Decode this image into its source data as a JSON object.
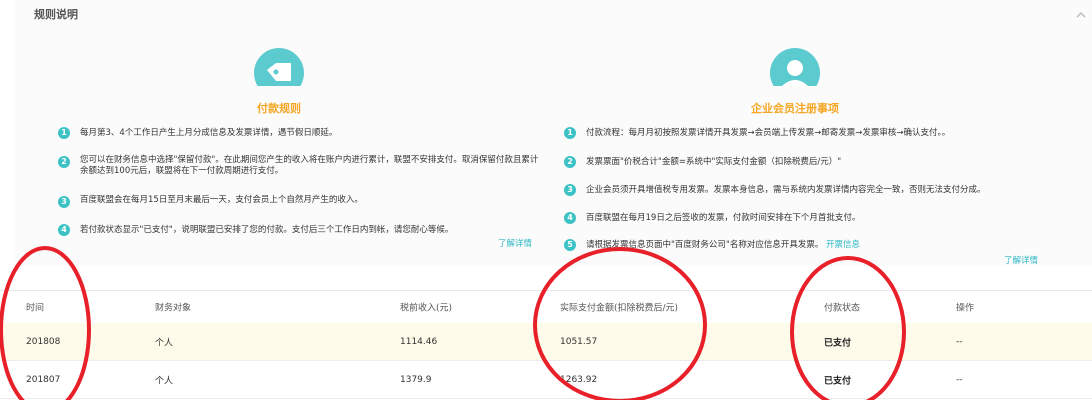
{
  "rules": {
    "title": "规则说明",
    "payment": {
      "heading": "付款规则",
      "items": [
        "每月第3、4个工作日产生上月分成信息及发票详情，遇节假日顺延。",
        "您可以在财务信息中选择\"保留付款\"。在此期间您产生的收入将在账户内进行累计，联盟不安排支付。取消保留付款且累计余额达到100元后，联盟将在下一付款周期进行支付。",
        "百度联盟会在每月15日至月末最后一天，支付会员上个自然月产生的收入。",
        "若付款状态显示\"已支付\"，说明联盟已安排了您的付款。支付后三个工作日内到帐，请您耐心等候。"
      ],
      "link": "了解详情"
    },
    "enterprise": {
      "heading": "企业会员注册事项",
      "items": [
        "付款流程：每月月初按照发票详情开具发票→会员端上传发票→邮寄发票→发票审核→确认支付。。",
        "发票票面\"价税合计\"金额=系统中\"实际支付金额（扣除税费后/元）\"",
        "企业会员须开具增值税专用发票。发票本身信息，需与系统内发票详情内容完全一致，否则无法支付分成。",
        "百度联盟在每月19日之后签收的发票，付款时间安排在下个月首批支付。",
        "请根据发票信息页面中\"百度财务公司\"名称对应信息开具发票。"
      ],
      "invoice_link": "开票信息",
      "link": "了解详情"
    },
    "numbers": [
      "1",
      "2",
      "3",
      "4",
      "5"
    ]
  },
  "table": {
    "headers": [
      "时间",
      "财务对象",
      "税前收入(元)",
      "实际支付金额(扣除税费后/元)",
      "付款状态",
      "操作"
    ],
    "rows": [
      [
        "201808",
        "个人",
        "1114.46",
        "1051.57",
        "已支付",
        "--"
      ],
      [
        "201807",
        "个人",
        "1379.9",
        "1263.92",
        "已支付",
        "--"
      ]
    ]
  },
  "colors": {
    "accent_teal": "#3cc2c5",
    "heading_orange": "#f5a623",
    "highlight_row": "#fffbea",
    "annotation_red": "#e8202a"
  }
}
